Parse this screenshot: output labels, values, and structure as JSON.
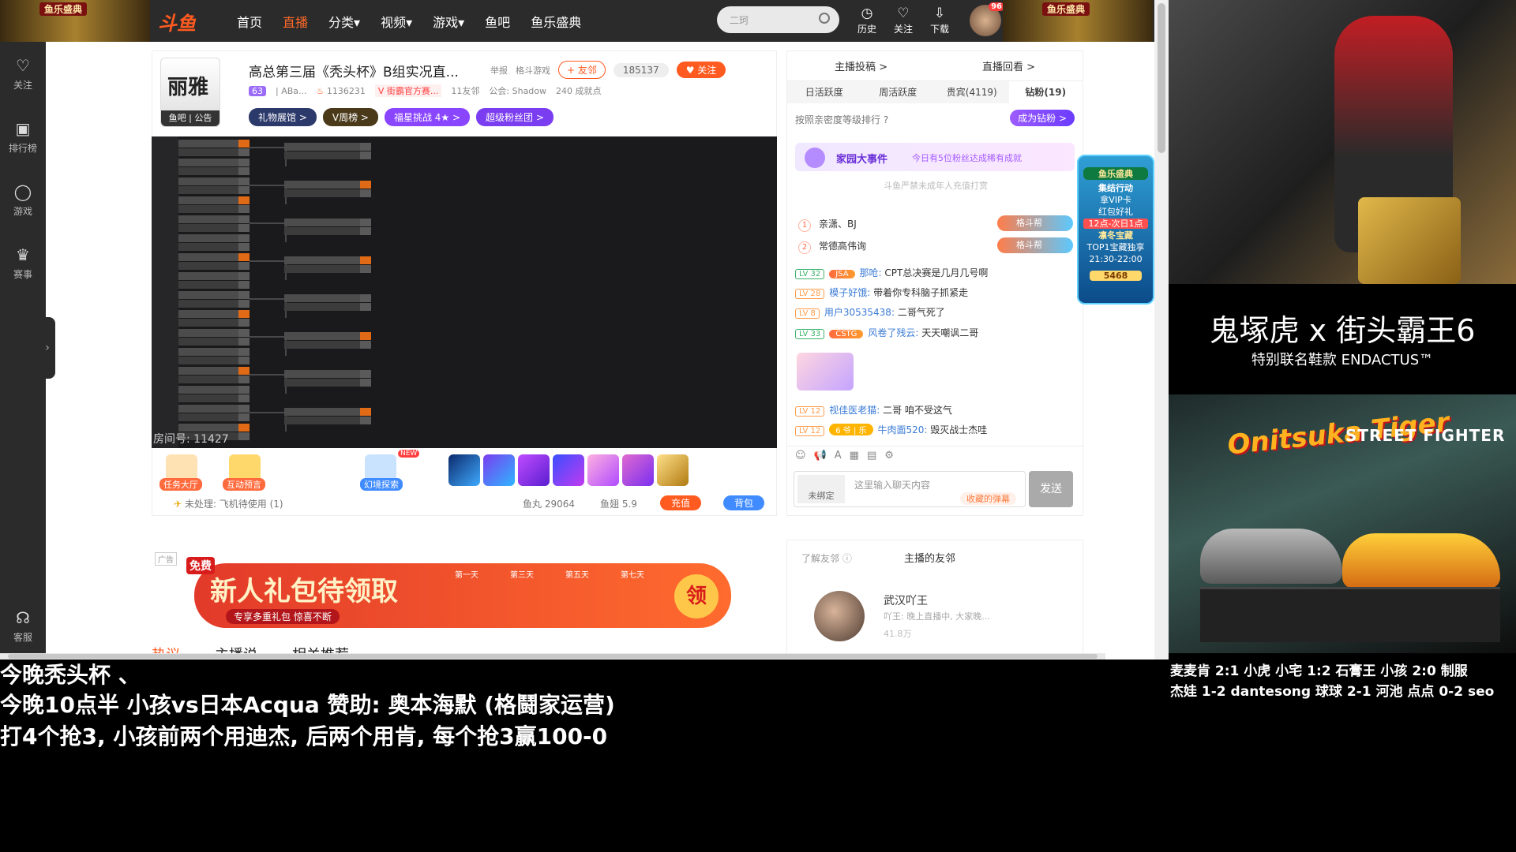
{
  "topnav": {
    "banner_label": "鱼乐盛典",
    "logo": "斗鱼",
    "items": [
      "首页",
      "直播",
      "分类▾",
      "视频▾",
      "游戏▾",
      "鱼吧",
      "鱼乐盛典"
    ],
    "active_index": 1,
    "search_placeholder": "二珂",
    "tools": [
      {
        "icon": "history-icon",
        "label": "历史"
      },
      {
        "icon": "heart-icon",
        "label": "关注"
      },
      {
        "icon": "download-icon",
        "label": "下载"
      }
    ],
    "avatar_badge": "96"
  },
  "sidebar": {
    "items": [
      {
        "icon": "heart-icon",
        "label": "关注"
      },
      {
        "icon": "rank-icon",
        "label": "排行榜"
      },
      {
        "icon": "game-icon",
        "label": "游戏"
      },
      {
        "icon": "trophy-icon",
        "label": "赛事"
      }
    ],
    "service": "客服"
  },
  "room": {
    "avatar_text": "丽雅",
    "avatar_foot": "鱼吧 | 公告",
    "title": "高总第三届《秃头杯》B组实况直...",
    "report": "举报",
    "category": "格斗游戏",
    "friend_btn": "+ 友邻",
    "follow_count": "185137",
    "follow_btn": "♥ 关注",
    "level": "63",
    "host_short": "| ABa...",
    "heat": "1136231",
    "official": "V 街霸官方赛...",
    "friends_count": "11友邻",
    "guild": "公会: Shadow",
    "achievement": "240 成就点",
    "tags": [
      "礼物展馆 >",
      "V周榜 >",
      "福星挑战 4★ >",
      "超级粉丝团 >"
    ],
    "room_id": "房间号: 11427"
  },
  "gifts": {
    "left_labels": [
      "任务大厅",
      "互动预言",
      "幻境探索"
    ],
    "new_badge": "NEW",
    "pending": "未处理: 飞机待使用 (1)",
    "fish_balls": "鱼丸 29064",
    "fish_fins": "鱼翅 5.9",
    "charge": "充值",
    "bag": "背包"
  },
  "ad": {
    "badge": "广告",
    "free": "免费",
    "title": "新人礼包待领取",
    "subtitle": "专享多重礼包 惊喜不断",
    "day_labels": [
      "第一天",
      "第三天",
      "第五天",
      "第七天"
    ],
    "claim": "领"
  },
  "bottom_tabs": [
    "热议",
    "主播说",
    "相关推荐"
  ],
  "rpanel": {
    "head": [
      "主播投稿 >",
      "直播回看 >"
    ],
    "tabs": [
      "日活跃度",
      "周活跃度",
      "贵宾(4119)",
      "钻粉(19)"
    ],
    "active_tab": 3,
    "sort_hint": "按照亲密度等级排行 ?",
    "fans_btn": "成为钻粉 >",
    "event_title": "家园大事件",
    "event_desc": "今日有5位粉丝达成稀有成就",
    "note": "斗鱼严禁未成年人充值打赏",
    "ranks": [
      {
        "n": "1",
        "name": "亲潇、BJ",
        "badge": "格斗帮"
      },
      {
        "n": "2",
        "name": "常德高伟询",
        "badge": "格斗帮"
      }
    ],
    "chat": [
      {
        "lv": "LV 32",
        "fan": "JSA",
        "name": "那呛:",
        "msg": "CPT总决赛是几月几号啊",
        "color": "#3bb36a"
      },
      {
        "lv": "LV 28",
        "fan": "",
        "name": "模子好饿:",
        "msg": "带着你专科脑子抓紧走",
        "color": "#ff9b4a"
      },
      {
        "lv": "LV 8",
        "fan": "",
        "name": "用户30535438:",
        "msg": "二哥气死了",
        "color": "#ff9b4a"
      },
      {
        "lv": "LV 33",
        "fan": "CSTG",
        "name": "风卷了残云:",
        "msg": "天天嘲讽二哥",
        "color": "#3bb36a"
      },
      {
        "lv": "LV 12",
        "fan": "",
        "name": "视佳医老猫:",
        "msg": "二哥 咱不受这气",
        "color": "#ff9b4a"
      },
      {
        "lv": "LV 12",
        "fan": "6 爷 | 乐",
        "name": "牛肉面520:",
        "msg": "毁灭战士杰哇",
        "color": "#ff9b4a"
      }
    ],
    "not_bound": "未绑定",
    "input_placeholder": "这里输入聊天内容",
    "barrage": "收藏的弹幕",
    "send": "发送"
  },
  "promo": {
    "header": "鱼乐盛典",
    "line1": "集结行动",
    "line2": "拿VIP卡",
    "line3": "红包好礼",
    "time": "12点-次日1点",
    "box": "凛冬宝藏",
    "top1": "TOP1宝藏独享",
    "top1_time": "21:30-22:00",
    "count": "5468"
  },
  "friends": {
    "hd": "了解友邻 ⓘ",
    "hd2": "主播的友邻",
    "name": "武汉吖王",
    "desc": "吖王: 晚上直播中, 大家晚...",
    "heat": "41.8万"
  },
  "poster": {
    "title": "鬼塚虎 x 街头霸王6",
    "subtitle": "特别联名鞋款 ENDACTUS™",
    "brand1": "Onitsuka Tiger",
    "brand2": "STREET FIGHTER"
  },
  "overlay": {
    "line1": "今晚秃头杯 、",
    "line2": "今晚10点半 小孩vs日本Acqua 赞助: 奥本海默 (格鬪家运营)",
    "line3": "打4个抢3, 小孩前两个用迪杰, 后两个用肯, 每个抢3赢100-0"
  },
  "scores": {
    "line1": "麦麦肯 2:1 小虎  小宅 1:2 石膏王  小孩 2:0 制服",
    "line2": "杰娃 1-2 dantesong  球球 2-1 河池  点点 0-2 seo"
  },
  "colors": {
    "brand": "#ff5a1f",
    "topbar": "#2b2b2b",
    "accent_purple": "#9b6cf7"
  }
}
